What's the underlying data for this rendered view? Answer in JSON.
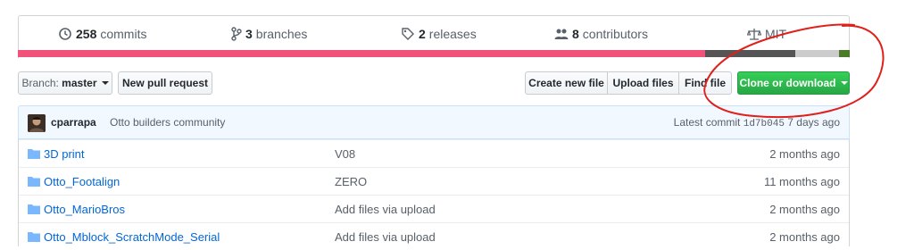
{
  "summary": {
    "commits": {
      "count": "258",
      "label": "commits",
      "icon": "history-icon"
    },
    "branches": {
      "count": "3",
      "label": "branches",
      "icon": "branch-icon"
    },
    "releases": {
      "count": "2",
      "label": "releases",
      "icon": "tag-icon"
    },
    "contributors": {
      "count": "8",
      "label": "contributors",
      "icon": "people-icon"
    },
    "license": {
      "label": "MIT",
      "icon": "law-icon"
    }
  },
  "language_bar": [
    {
      "color": "#f1527a",
      "share": 0.826
    },
    {
      "color": "#555555",
      "share": 0.109
    },
    {
      "color": "#cccccc",
      "share": 0.052
    },
    {
      "color": "#4c7a2b",
      "share": 0.013
    }
  ],
  "toolbar": {
    "branch_prefix": "Branch:",
    "branch_name": "master",
    "new_pull_request": "New pull request",
    "create_new_file": "Create new file",
    "upload_files": "Upload files",
    "find_file": "Find file",
    "clone_or_download": "Clone or download"
  },
  "commit": {
    "author": "cparrapa",
    "message": "Otto builders community",
    "latest_label": "Latest commit",
    "sha": "1d7b045",
    "age": "7 days ago"
  },
  "files": [
    {
      "name": "3D print",
      "message": "V08",
      "age": "2 months ago"
    },
    {
      "name": "Otto_Footalign",
      "message": "ZERO",
      "age": "11 months ago"
    },
    {
      "name": "Otto_MarioBros",
      "message": "Add files via upload",
      "age": "2 months ago"
    },
    {
      "name": "Otto_Mblock_ScratchMode_Serial",
      "message": "Add files via upload",
      "age": "2 months ago"
    }
  ],
  "colors": {
    "link": "#0366d6",
    "green_button": "#28a745",
    "annotation_red": "#e0201b"
  }
}
